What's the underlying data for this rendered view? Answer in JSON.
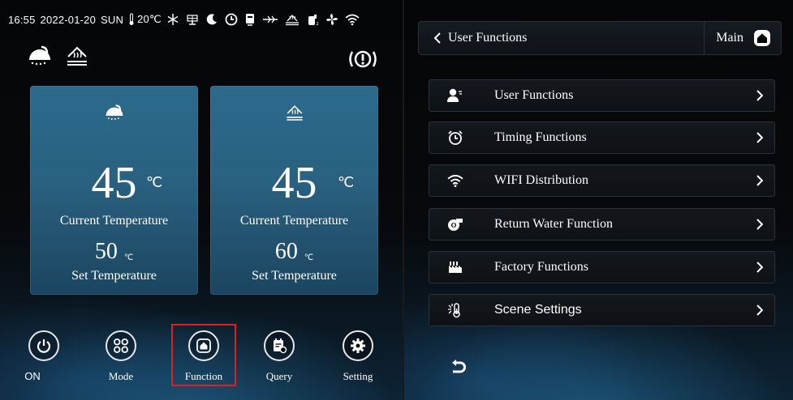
{
  "status_bar": {
    "time": "16:55",
    "date": "2022-01-20",
    "weekday": "SUN",
    "temperature": "20℃",
    "icons": [
      "thermometer-icon",
      "defrost-icon",
      "solar-icon",
      "night-mode-icon",
      "timer-icon",
      "water-tank-icon",
      "electric-heater-icon",
      "floor-heating-icon",
      "pump-icon",
      "fan-icon",
      "wifi-icon"
    ]
  },
  "mode_icons": [
    "shower-icon",
    "floor-heating-icon"
  ],
  "alarm_icon": "alarm-icon",
  "cards": [
    {
      "icon": "shower-icon",
      "current_value": "45",
      "current_unit": "℃",
      "current_label": "Current Temperature",
      "set_value": "50",
      "set_unit": "℃",
      "set_label": "Set Temperature"
    },
    {
      "icon": "floor-heating-icon",
      "current_value": "45",
      "current_unit": "℃",
      "current_label": "Current Temperature",
      "set_value": "60",
      "set_unit": "℃",
      "set_label": "Set Temperature"
    }
  ],
  "nav": [
    {
      "label": "ON",
      "icon": "power-icon"
    },
    {
      "label": "Mode",
      "icon": "mode-grid-icon"
    },
    {
      "label": "Function",
      "icon": "home-icon",
      "selected": true
    },
    {
      "label": "Query",
      "icon": "query-icon"
    },
    {
      "label": "Setting",
      "icon": "gear-icon"
    }
  ],
  "right": {
    "header_title": "User Functions",
    "main_label": "Main",
    "menu": [
      {
        "label": "User Functions",
        "icon": "user-icon"
      },
      {
        "label": "Timing Functions",
        "icon": "alarm-clock-icon"
      },
      {
        "label": "WIFI Distribution",
        "icon": "wifi-icon"
      },
      {
        "label": "Return Water Function",
        "icon": "pump-icon"
      },
      {
        "label": "Factory Functions",
        "icon": "factory-icon"
      },
      {
        "label": "Scene Settings",
        "icon": "scene-icon"
      }
    ]
  },
  "colors": {
    "card": "#2a6180",
    "highlight": "#e02020",
    "text": "#ffffff"
  }
}
